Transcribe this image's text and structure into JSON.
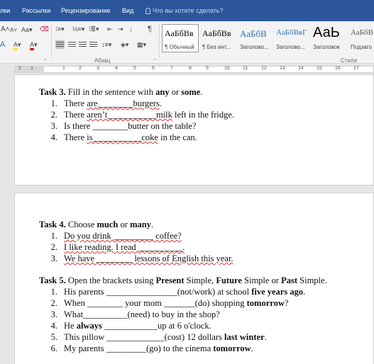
{
  "ribbon_tabs": {
    "t0": "лки",
    "t1": "Рассылки",
    "t2": "Рецензирование",
    "t3": "Вид",
    "tell_me": "Что вы хотите сделать?"
  },
  "ribbon": {
    "font_grow": "A",
    "font_shrink": "A",
    "change_case": "Aa",
    "font_color": "A",
    "highlight": "A",
    "paragraph_label": "Абзац",
    "styles_label": "Стили",
    "pilcrow": "¶",
    "sort": "↓",
    "styles": [
      {
        "preview": "АаБбВв",
        "name": "¶ Обычный"
      },
      {
        "preview": "АаБбВв",
        "name": "¶ Без инт..."
      },
      {
        "preview": "АаБбВ",
        "name": "Заголово..."
      },
      {
        "preview": "АаБбВвГ",
        "name": "Заголово..."
      },
      {
        "preview": "АаЬ",
        "name": "Заголовок"
      },
      {
        "preview": "АаБбВ",
        "name": "Подзаго"
      }
    ]
  },
  "ruler": {
    "numbers": [
      "2",
      "1",
      "1",
      "2",
      "3",
      "4",
      "5",
      "6",
      "7",
      "8",
      "9",
      "10",
      "11",
      "12",
      "13",
      "14",
      "15",
      "16",
      "17"
    ]
  },
  "doc": {
    "task3": {
      "title_bold": "Task 3.",
      "title_a": " Fill in the sentence with ",
      "title_b": "any",
      "title_c": " or ",
      "title_d": "some",
      "title_e": ".",
      "items": [
        {
          "n": "1.",
          "a": "There ",
          "b": "are________burgers",
          "c": "."
        },
        {
          "n": "2.",
          "a": "There ",
          "b": "aren’t___________milk",
          "c": " left in the fridge."
        },
        {
          "n": "3.",
          "a": "Is there ________butter on the table?",
          "b": "",
          "c": ""
        },
        {
          "n": "4.",
          "a": "There ",
          "b": "is___________coke",
          "c": " in the can."
        }
      ]
    },
    "task4": {
      "title_bold": "Task 4.",
      "title_a": " Choose ",
      "title_b": "much",
      "title_c": " or ",
      "title_d": "many",
      "title_e": ".",
      "items": [
        {
          "n": "1.",
          "text": "Do you drink _________ coffee?"
        },
        {
          "n": "2.",
          "text": "I like reading. I read __________."
        },
        {
          "n": "3.",
          "text": "We have ________ lessons of English this year."
        }
      ]
    },
    "task5": {
      "title_bold": "Task 5.",
      "title_a": " Open the brackets using ",
      "title_b": "Present",
      "title_c": " Simple, ",
      "title_d": "Future",
      "title_e": " Simple or ",
      "title_f": "Past",
      "title_g": " Simple.",
      "items": [
        {
          "n": "1.",
          "a": "His parents ________________(not/work) at school ",
          "b": "five years ago",
          "c": "."
        },
        {
          "n": "2.",
          "a": "When ________ your mom _______(do) shopping ",
          "b": "tomorrow",
          "c": "?"
        },
        {
          "n": "3.",
          "a": "What__________(need) to buy in the shop?",
          "b": "",
          "c": ""
        },
        {
          "n": "4.",
          "a": "He ",
          "b": "always",
          "c": " ____________up at 6 o'clock."
        },
        {
          "n": "5.",
          "a": "This pillow _____________(cost) 12 dollars ",
          "b": "last winter",
          "c": "."
        },
        {
          "n": "6.",
          "a": "My parents _________(go) to the cinema ",
          "b": "tomorrow",
          "c": "."
        }
      ]
    }
  }
}
